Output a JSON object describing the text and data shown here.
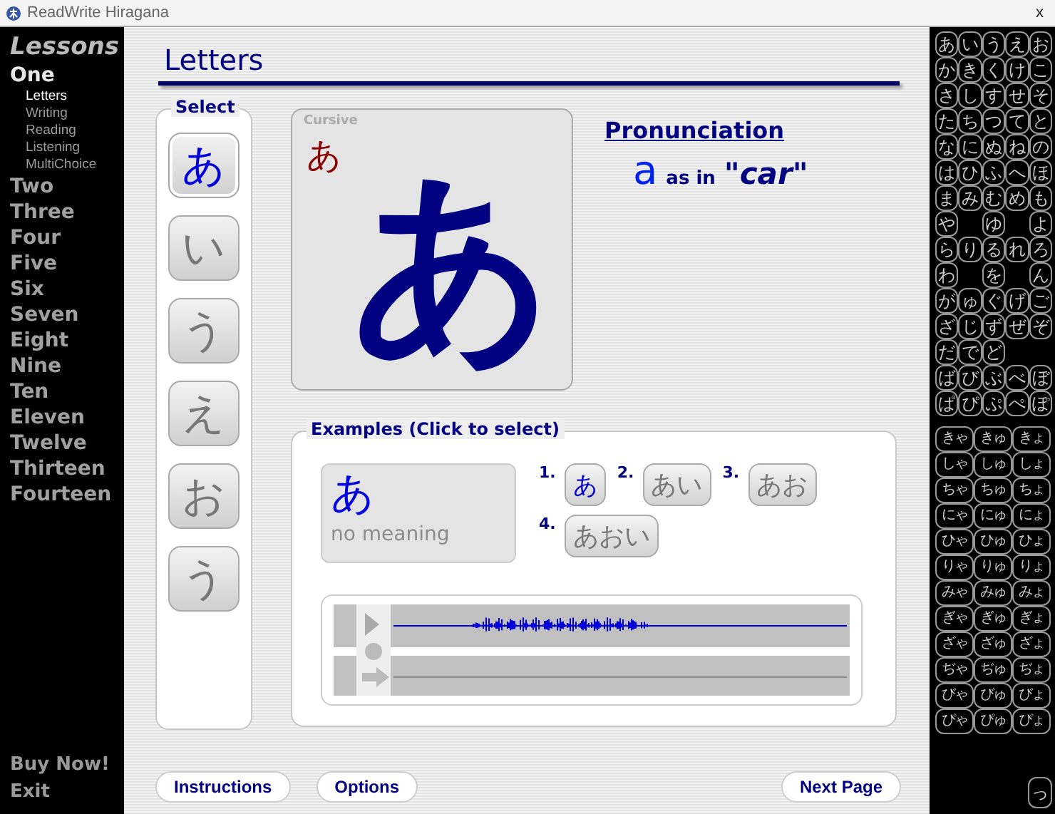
{
  "window": {
    "title": "ReadWrite Hiragana",
    "close": "x"
  },
  "sidebar": {
    "heading": "Lessons",
    "lessons": [
      {
        "label": "One",
        "selected": true,
        "children": [
          {
            "label": "Letters",
            "selected": true
          },
          {
            "label": "Writing",
            "selected": false
          },
          {
            "label": "Reading",
            "selected": false
          },
          {
            "label": "Listening",
            "selected": false
          },
          {
            "label": "MultiChoice",
            "selected": false
          }
        ]
      },
      {
        "label": "Two",
        "selected": false
      },
      {
        "label": "Three",
        "selected": false
      },
      {
        "label": "Four",
        "selected": false
      },
      {
        "label": "Five",
        "selected": false
      },
      {
        "label": "Six",
        "selected": false
      },
      {
        "label": "Seven",
        "selected": false
      },
      {
        "label": "Eight",
        "selected": false
      },
      {
        "label": "Nine",
        "selected": false
      },
      {
        "label": "Ten",
        "selected": false
      },
      {
        "label": "Eleven",
        "selected": false
      },
      {
        "label": "Twelve",
        "selected": false
      },
      {
        "label": "Thirteen",
        "selected": false
      },
      {
        "label": "Fourteen",
        "selected": false
      }
    ],
    "footer": [
      "Buy Now!",
      "Exit"
    ]
  },
  "page_title": "Letters",
  "select": {
    "label": "Select",
    "items": [
      {
        "char": "あ",
        "selected": true
      },
      {
        "char": "い",
        "selected": false
      },
      {
        "char": "う",
        "selected": false
      },
      {
        "char": "え",
        "selected": false
      },
      {
        "char": "お",
        "selected": false
      },
      {
        "char": "う",
        "selected": false
      }
    ]
  },
  "card": {
    "label": "Cursive",
    "cursive": "あ",
    "char": "あ"
  },
  "pronunciation": {
    "heading": "Pronunciation",
    "romaji": "a",
    "as_in": "as in",
    "example": "\"car\""
  },
  "examples": {
    "label": "Examples (Click to select)",
    "word": "あ",
    "meaning": "no meaning",
    "items": [
      {
        "number": "1.",
        "word": "あ",
        "selected": true
      },
      {
        "number": "2.",
        "word": "あい",
        "selected": false
      },
      {
        "number": "3.",
        "word": "あお",
        "selected": false
      },
      {
        "number": "4.",
        "word": "あおい",
        "selected": false
      }
    ]
  },
  "buttons": [
    {
      "label": "Instructions"
    },
    {
      "label": "Options"
    },
    {
      "label": "Next Page"
    }
  ],
  "kana": {
    "table": [
      [
        "あ",
        "い",
        "う",
        "え",
        "お"
      ],
      [
        "か",
        "き",
        "く",
        "け",
        "こ"
      ],
      [
        "さ",
        "し",
        "す",
        "せ",
        "そ"
      ],
      [
        "た",
        "ち",
        "つ",
        "て",
        "と"
      ],
      [
        "な",
        "に",
        "ぬ",
        "ね",
        "の"
      ],
      [
        "は",
        "ひ",
        "ふ",
        "へ",
        "ほ"
      ],
      [
        "ま",
        "み",
        "む",
        "め",
        "も"
      ],
      [
        "や",
        {
          "kind": "blank"
        },
        "ゆ",
        {
          "kind": "blank"
        },
        "よ"
      ],
      [
        "ら",
        "り",
        "る",
        "れ",
        "ろ"
      ],
      [
        "わ",
        {
          "kind": "blank"
        },
        "を",
        {
          "kind": "blank"
        },
        "ん"
      ],
      [
        "が",
        "ゅ",
        "ぐ",
        "げ",
        "ご"
      ],
      [
        "ざ",
        "じ",
        "ず",
        "ぜ",
        "ぞ"
      ],
      [
        "だ",
        "で",
        "ど",
        {
          "kind": "blank"
        },
        {
          "kind": "blank"
        }
      ],
      [
        "ば",
        "び",
        "ぶ",
        "べ",
        "ぼ"
      ],
      [
        "ぱ",
        "ぴ",
        "ぷ",
        "ぺ",
        "ぽ"
      ]
    ],
    "combos": [
      [
        "きゃ",
        "きゅ",
        "きょ"
      ],
      [
        "しゃ",
        "しゅ",
        "しょ"
      ],
      [
        "ちゃ",
        "ちゅ",
        "ちょ"
      ],
      [
        "にゃ",
        "にゅ",
        "にょ"
      ],
      [
        "ひゃ",
        "ひゅ",
        "ひょ"
      ],
      [
        "りゃ",
        "りゅ",
        "りょ"
      ],
      [
        "みゃ",
        "みゅ",
        "みょ"
      ],
      [
        "ぎゃ",
        "ぎゅ",
        "ぎょ"
      ],
      [
        "ざゃ",
        "ざゅ",
        "ざょ"
      ],
      [
        "ぢゃ",
        "ぢゅ",
        "ぢょ"
      ],
      [
        "びゃ",
        "びゅ",
        "びょ"
      ],
      [
        "ぴゃ",
        "ぴゅ",
        "ぴょ"
      ]
    ],
    "small_tsu": "っ"
  }
}
